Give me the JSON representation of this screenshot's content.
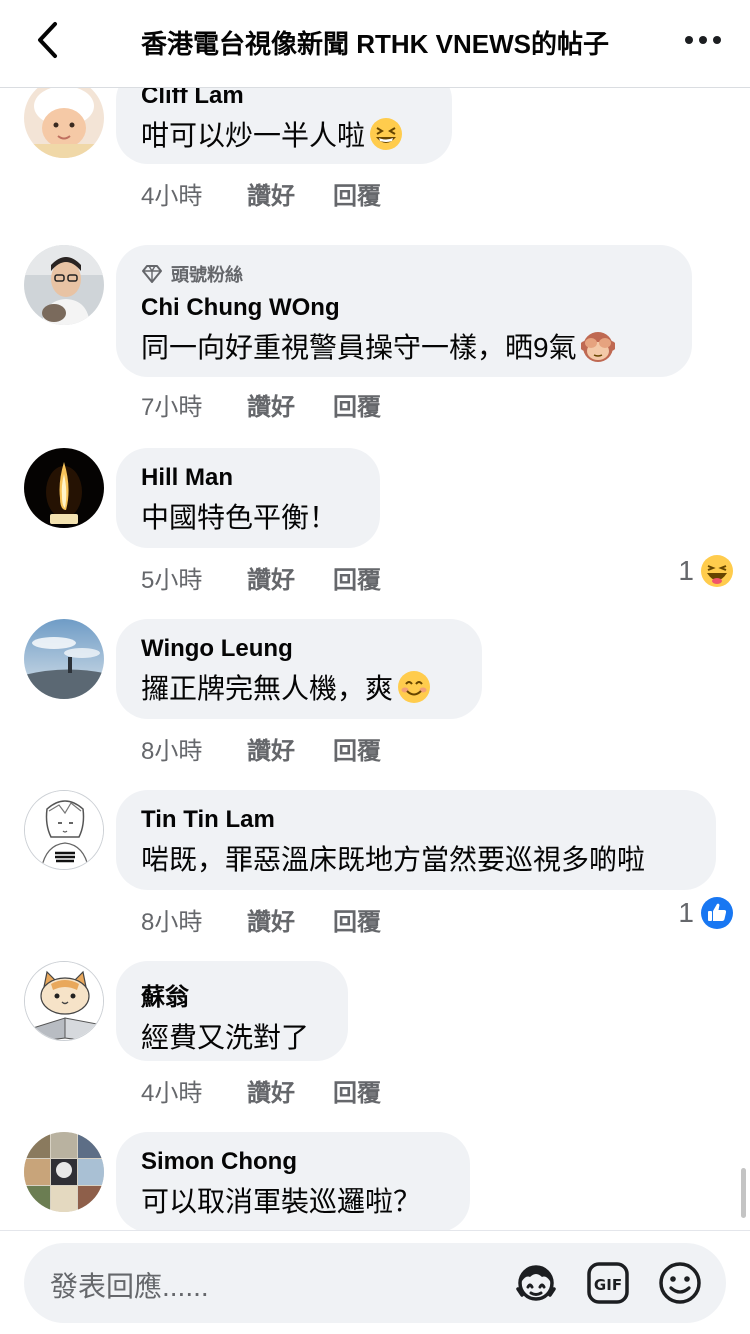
{
  "header": {
    "title": "香港電台視像新聞 RTHK VNEWS的帖子"
  },
  "labels": {
    "like": "讚好",
    "reply": "回覆"
  },
  "comments": [
    {
      "author": "Cliff Lam",
      "text": "咁可以炒一半人啦",
      "emoji": "grinning-squint-emoji",
      "time": "4小時"
    },
    {
      "fan_badge": "頭號粉絲",
      "author": "Chi Chung WOng",
      "text": "同一向好重視警員操守一樣，晒9氣",
      "emoji": "see-no-evil-monkey-emoji",
      "time": "7小時"
    },
    {
      "author": "Hill Man",
      "text": "中國特色平衡！",
      "time": "5小時",
      "reaction_count": "1",
      "reaction": "haha-reaction-icon"
    },
    {
      "author": "Wingo Leung",
      "text": "攞正牌完無人機，爽",
      "emoji": "smiling-face-emoji",
      "time": "8小時"
    },
    {
      "author": "Tin Tin Lam",
      "text": "啱既，罪惡溫床既地方當然要巡視多啲啦",
      "time": "8小時",
      "reaction_count": "1",
      "reaction": "like-reaction-icon"
    },
    {
      "author": "蘇翁",
      "text": "經費又洗對了",
      "time": "4小時"
    },
    {
      "author": "Simon Chong",
      "text": "可以取消軍裝巡邏啦？"
    }
  ],
  "composer": {
    "placeholder": "發表回應......"
  },
  "colors": {
    "bubble": "#f0f2f5",
    "secondary_text": "#65676b",
    "like_blue": "#1877f2",
    "emoji_yellow": "#ffcc4d"
  }
}
